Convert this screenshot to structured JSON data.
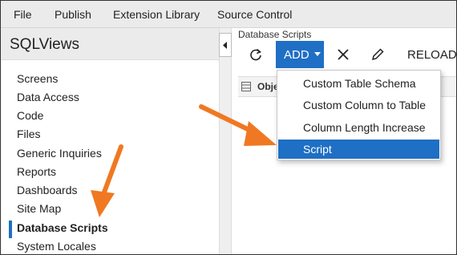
{
  "menubar": {
    "items": [
      "File",
      "Publish",
      "Extension Library",
      "Source Control"
    ]
  },
  "sidebar": {
    "title": "SQLViews",
    "items": [
      {
        "label": "Screens"
      },
      {
        "label": "Data Access"
      },
      {
        "label": "Code"
      },
      {
        "label": "Files"
      },
      {
        "label": "Generic Inquiries"
      },
      {
        "label": "Reports"
      },
      {
        "label": "Dashboards"
      },
      {
        "label": "Site Map"
      },
      {
        "label": "Database Scripts",
        "active": true
      },
      {
        "label": "System Locales"
      }
    ]
  },
  "main": {
    "title": "Database Scripts",
    "toolbar": {
      "add_label": "ADD",
      "reload_label": "RELOAD"
    },
    "grid": {
      "first_column": "Obje"
    }
  },
  "dropdown": {
    "items": [
      {
        "label": "Custom Table Schema"
      },
      {
        "label": "Custom Column to Table"
      },
      {
        "label": "Column Length Increase"
      },
      {
        "label": "Script",
        "highlighted": true
      }
    ]
  },
  "colors": {
    "accent": "#1f6fc5",
    "annotation_arrow": "#f07822",
    "menubar_bg": "#ebebeb"
  },
  "icons": {
    "refresh": "refresh-icon",
    "dropdown": "chevron-down-icon",
    "delete": "close-icon",
    "edit": "pencil-icon",
    "collapse": "caret-left-icon",
    "grid_settings": "grid-settings-icon"
  }
}
